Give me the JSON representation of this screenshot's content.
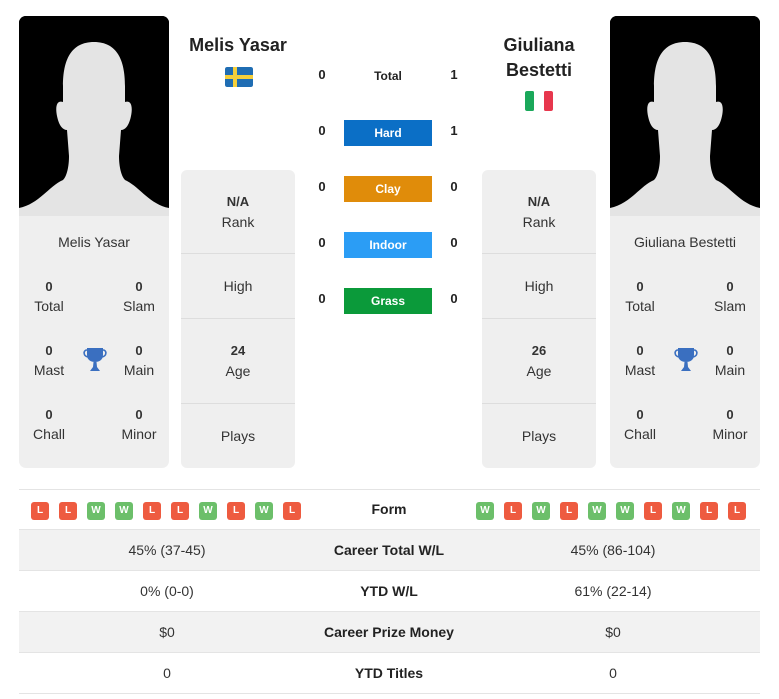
{
  "players": [
    {
      "name": "Melis Yasar",
      "country": "Sweden",
      "flag_icon": "sweden-flag-icon",
      "card_name": "Melis Yasar",
      "titles": {
        "total": "0",
        "slam": "0",
        "masters": "0",
        "main": "0",
        "challenger": "0",
        "minor": "0"
      },
      "rank": "N/A",
      "high": "",
      "age": "24",
      "plays": ""
    },
    {
      "name": "Giuliana Bestetti",
      "name_line1": "Giuliana",
      "name_line2": "Bestetti",
      "country": "Italy",
      "flag_icon": "italy-flag-icon",
      "card_name": "Giuliana Bestetti",
      "titles": {
        "total": "0",
        "slam": "0",
        "masters": "0",
        "main": "0",
        "challenger": "0",
        "minor": "0"
      },
      "rank": "N/A",
      "high": "",
      "age": "26",
      "plays": ""
    }
  ],
  "labels": {
    "total": "Total",
    "slam": "Slam",
    "masters": "Mast",
    "main": "Main",
    "challenger": "Chall",
    "minor": "Minor",
    "rank": "Rank",
    "high": "High",
    "age": "Age",
    "plays": "Plays"
  },
  "head_to_head": {
    "total": {
      "label": "Total",
      "p1": "0",
      "p2": "1"
    },
    "surfaces": [
      {
        "label": "Hard",
        "p1": "0",
        "p2": "1",
        "color": "#0b6fc6"
      },
      {
        "label": "Clay",
        "p1": "0",
        "p2": "0",
        "color": "#e08c0a"
      },
      {
        "label": "Indoor",
        "p1": "0",
        "p2": "0",
        "color": "#2b9df5"
      },
      {
        "label": "Grass",
        "p1": "0",
        "p2": "0",
        "color": "#0b9a3a"
      }
    ]
  },
  "form": {
    "label": "Form",
    "p1": [
      "L",
      "L",
      "W",
      "W",
      "L",
      "L",
      "W",
      "L",
      "W",
      "L"
    ],
    "p2": [
      "W",
      "L",
      "W",
      "L",
      "W",
      "W",
      "L",
      "W",
      "L",
      "L"
    ]
  },
  "stats": [
    {
      "label": "Career Total W/L",
      "p1": "45% (37-45)",
      "p2": "45% (86-104)"
    },
    {
      "label": "YTD W/L",
      "p1": "0% (0-0)",
      "p2": "61% (22-14)"
    },
    {
      "label": "Career Prize Money",
      "p1": "$0",
      "p2": "$0"
    },
    {
      "label": "YTD Titles",
      "p1": "0",
      "p2": "0"
    }
  ]
}
